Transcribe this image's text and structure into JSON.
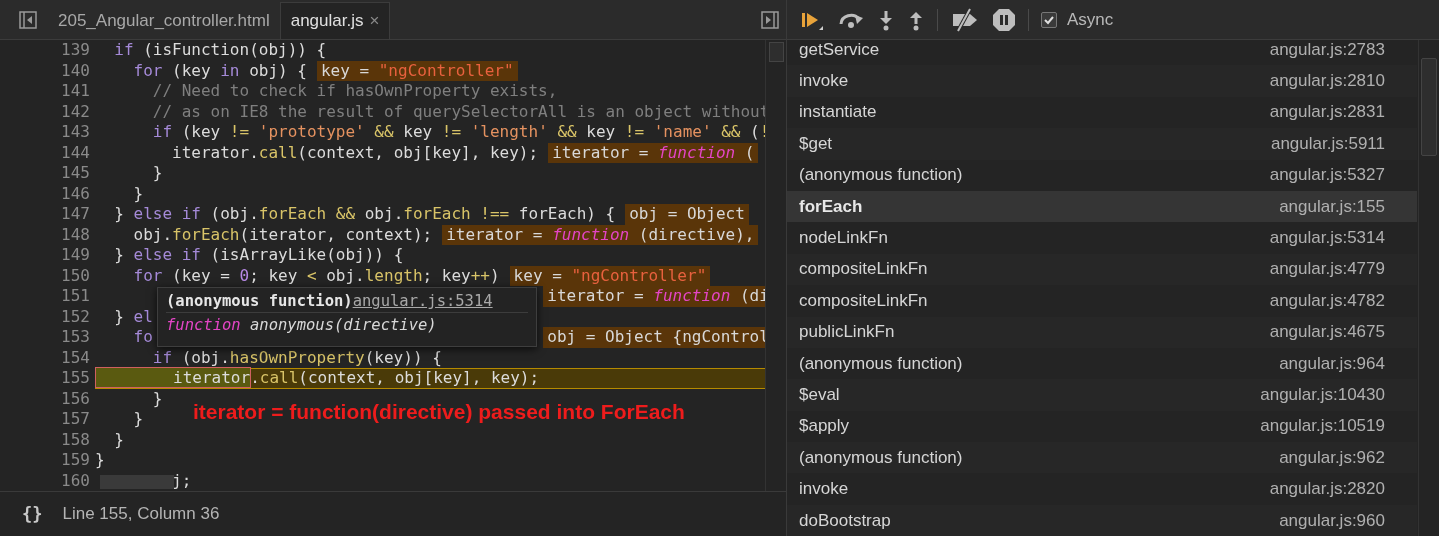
{
  "editor": {
    "tabs": [
      {
        "label": "205_Angular_controller.html",
        "selected": false
      },
      {
        "label": "angular.js",
        "selected": true,
        "close": "×"
      }
    ],
    "code_lines": [
      {
        "number": "139",
        "kind": "code",
        "current": false,
        "tokens": [
          {
            "kind": "kw",
            "text": "  if"
          },
          {
            "kind": "plain",
            "text": " (isFunction(obj)) {"
          }
        ]
      },
      {
        "number": "140",
        "kind": "code",
        "current": false,
        "tokens": [
          {
            "kind": "kw",
            "text": "    for"
          },
          {
            "kind": "plain",
            "text": " (key "
          },
          {
            "kind": "kw",
            "text": "in"
          },
          {
            "kind": "plain",
            "text": " obj) {"
          }
        ],
        "inline": [
          {
            "kind": "plain",
            "text": "key = "
          },
          {
            "kind": "str",
            "text": "\"ngController\""
          }
        ]
      },
      {
        "number": "141",
        "kind": "code",
        "current": false,
        "tokens": [
          {
            "kind": "cm",
            "text": "      // Need to check if hasOwnProperty exists,"
          }
        ]
      },
      {
        "number": "142",
        "kind": "code",
        "current": false,
        "tokens": [
          {
            "kind": "cm",
            "text": "      // as on IE8 the result of querySelectorAll is an object without"
          }
        ]
      },
      {
        "number": "143",
        "kind": "code",
        "current": false,
        "tokens": [
          {
            "kind": "kw",
            "text": "      if"
          },
          {
            "kind": "plain",
            "text": " (key "
          },
          {
            "kind": "op",
            "text": "!= "
          },
          {
            "kind": "str",
            "text": "'prototype'"
          },
          {
            "kind": "op",
            "text": " && "
          },
          {
            "kind": "plain",
            "text": "key "
          },
          {
            "kind": "op",
            "text": "!= "
          },
          {
            "kind": "str",
            "text": "'length'"
          },
          {
            "kind": "op",
            "text": " && "
          },
          {
            "kind": "plain",
            "text": "key "
          },
          {
            "kind": "op",
            "text": "!= "
          },
          {
            "kind": "str",
            "text": "'name'"
          },
          {
            "kind": "op",
            "text": " && "
          },
          {
            "kind": "plain",
            "text": "("
          },
          {
            "kind": "op",
            "text": "!"
          }
        ]
      },
      {
        "number": "144",
        "kind": "code",
        "current": false,
        "tokens": [
          {
            "kind": "plain",
            "text": "        iterator."
          },
          {
            "kind": "op",
            "text": "call"
          },
          {
            "kind": "plain",
            "text": "(context, obj[key], key);"
          }
        ],
        "inline": [
          {
            "kind": "plain",
            "text": "iterator = "
          },
          {
            "kind": "fn",
            "text": "function"
          },
          {
            "kind": "plain",
            "text": " ("
          }
        ]
      },
      {
        "number": "145",
        "kind": "code",
        "current": false,
        "tokens": [
          {
            "kind": "plain",
            "text": "      }"
          }
        ]
      },
      {
        "number": "146",
        "kind": "code",
        "current": false,
        "tokens": [
          {
            "kind": "plain",
            "text": "    }"
          }
        ]
      },
      {
        "number": "147",
        "kind": "code",
        "current": false,
        "tokens": [
          {
            "kind": "plain",
            "text": "  } "
          },
          {
            "kind": "kw",
            "text": "else if"
          },
          {
            "kind": "plain",
            "text": " (obj."
          },
          {
            "kind": "op",
            "text": "forEach && "
          },
          {
            "kind": "plain",
            "text": "obj."
          },
          {
            "kind": "op",
            "text": "forEach !== "
          },
          {
            "kind": "plain",
            "text": "forEach) {"
          }
        ],
        "inline": [
          {
            "kind": "plain",
            "text": "obj = Object"
          }
        ]
      },
      {
        "number": "148",
        "kind": "code",
        "current": false,
        "tokens": [
          {
            "kind": "plain",
            "text": "    obj."
          },
          {
            "kind": "op",
            "text": "forEach"
          },
          {
            "kind": "plain",
            "text": "(iterator, context);"
          }
        ],
        "inline": [
          {
            "kind": "plain",
            "text": "iterator = "
          },
          {
            "kind": "fn",
            "text": "function"
          },
          {
            "kind": "plain",
            "text": " (directive),"
          }
        ]
      },
      {
        "number": "149",
        "kind": "code",
        "current": false,
        "tokens": [
          {
            "kind": "plain",
            "text": "  } "
          },
          {
            "kind": "kw",
            "text": "else if"
          },
          {
            "kind": "plain",
            "text": " (isArrayLike(obj)) {"
          }
        ]
      },
      {
        "number": "150",
        "kind": "code",
        "current": false,
        "tokens": [
          {
            "kind": "kw",
            "text": "    for"
          },
          {
            "kind": "plain",
            "text": " (key = "
          },
          {
            "kind": "num",
            "text": "0"
          },
          {
            "kind": "plain",
            "text": "; key "
          },
          {
            "kind": "op",
            "text": "< "
          },
          {
            "kind": "plain",
            "text": "obj."
          },
          {
            "kind": "op",
            "text": "length"
          },
          {
            "kind": "plain",
            "text": "; key"
          },
          {
            "kind": "op",
            "text": "++"
          },
          {
            "kind": "plain",
            "text": ")"
          }
        ],
        "inline": [
          {
            "kind": "plain",
            "text": "key = "
          },
          {
            "kind": "str",
            "text": "\"ngController\""
          }
        ]
      },
      {
        "number": "151",
        "kind": "covered",
        "current": false,
        "inline": [
          {
            "kind": "plain",
            "text": "iterator = "
          },
          {
            "kind": "fn",
            "text": "function"
          },
          {
            "kind": "plain",
            "text": " (di"
          }
        ]
      },
      {
        "number": "152",
        "kind": "code",
        "current": false,
        "tokens": [
          {
            "kind": "plain",
            "text": "  } "
          },
          {
            "kind": "kw",
            "text": "el"
          }
        ]
      },
      {
        "number": "153",
        "kind": "covered",
        "current": false,
        "tokens": [
          {
            "kind": "kw",
            "text": "    fo"
          }
        ],
        "inline": [
          {
            "kind": "plain",
            "text": "obj = Object {ngControl"
          }
        ]
      },
      {
        "number": "154",
        "kind": "code",
        "current": false,
        "tokens": [
          {
            "kind": "kw",
            "text": "      if"
          },
          {
            "kind": "plain",
            "text": " (obj."
          },
          {
            "kind": "op",
            "text": "hasOwnProperty"
          },
          {
            "kind": "plain",
            "text": "(key)) {"
          }
        ]
      },
      {
        "number": "155",
        "kind": "code",
        "current": true,
        "tokens": [
          {
            "kind": "plain",
            "text": "        iterator",
            "hovered": true
          },
          {
            "kind": "plain",
            "text": "."
          },
          {
            "kind": "op",
            "text": "call"
          },
          {
            "kind": "plain",
            "text": "(context, obj[key], key);"
          }
        ]
      },
      {
        "number": "156",
        "kind": "code",
        "current": false,
        "tokens": [
          {
            "kind": "plain",
            "text": "      }"
          }
        ]
      },
      {
        "number": "157",
        "kind": "code",
        "current": false,
        "tokens": [
          {
            "kind": "plain",
            "text": "    }"
          }
        ]
      },
      {
        "number": "158",
        "kind": "code",
        "current": false,
        "tokens": [
          {
            "kind": "plain",
            "text": "  }"
          }
        ]
      },
      {
        "number": "159",
        "kind": "code",
        "current": false,
        "tokens": [
          {
            "kind": "plain",
            "text": "}"
          }
        ]
      },
      {
        "number": "160",
        "kind": "scrolled",
        "current": false,
        "tokens": [
          {
            "kind": "plain",
            "text": "j;"
          }
        ]
      }
    ],
    "tooltip": {
      "title": "(anonymous function)",
      "link": "angular.js:5314",
      "keyword": "function",
      "signature": " anonymous(directive)"
    },
    "annotation": "iterator = function(directive) passed into ForEach",
    "status": {
      "format_glyph": "{}",
      "position": "Line 155, Column 36"
    }
  },
  "debugger": {
    "async": {
      "label": "Async",
      "checked": true
    },
    "call_stack": [
      {
        "name": "getService",
        "location": "angular.js:2783",
        "selected": false
      },
      {
        "name": "invoke",
        "location": "angular.js:2810",
        "selected": false
      },
      {
        "name": "instantiate",
        "location": "angular.js:2831",
        "selected": false
      },
      {
        "name": "$get",
        "location": "angular.js:5911",
        "selected": false
      },
      {
        "name": "(anonymous function)",
        "location": "angular.js:5327",
        "selected": false
      },
      {
        "name": "forEach",
        "location": "angular.js:155",
        "selected": true
      },
      {
        "name": "nodeLinkFn",
        "location": "angular.js:5314",
        "selected": false
      },
      {
        "name": "compositeLinkFn",
        "location": "angular.js:4779",
        "selected": false
      },
      {
        "name": "compositeLinkFn",
        "location": "angular.js:4782",
        "selected": false
      },
      {
        "name": "publicLinkFn",
        "location": "angular.js:4675",
        "selected": false
      },
      {
        "name": "(anonymous function)",
        "location": "angular.js:964",
        "selected": false
      },
      {
        "name": "$eval",
        "location": "angular.js:10430",
        "selected": false
      },
      {
        "name": "$apply",
        "location": "angular.js:10519",
        "selected": false
      },
      {
        "name": "(anonymous function)",
        "location": "angular.js:962",
        "selected": false
      },
      {
        "name": "invoke",
        "location": "angular.js:2820",
        "selected": false
      },
      {
        "name": "doBootstrap",
        "location": "angular.js:960",
        "selected": false
      }
    ]
  }
}
